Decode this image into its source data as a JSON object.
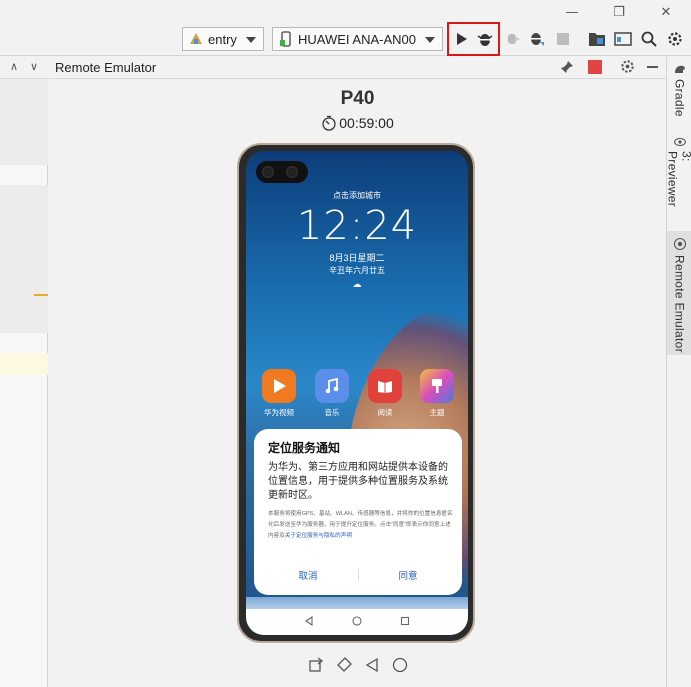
{
  "titlebar": {
    "minimize_glyph": "—",
    "restore_glyph": "❐",
    "close_glyph": "✕"
  },
  "toolbar": {
    "module_selector": "entry",
    "device_selector": "HUAWEI ANA-AN00",
    "icons": [
      "run-icon",
      "debug-icon",
      "attach-debugger-icon",
      "profile-icon",
      "stop-icon",
      "project-structure-icon",
      "sdk-manager-icon",
      "search-icon",
      "settings-icon"
    ]
  },
  "panel": {
    "title": "Remote Emulator",
    "device_name": "P40",
    "timer": "00:59:00"
  },
  "phone": {
    "lock_hint": "点击添加城市",
    "time": "12:24",
    "date": "8月3日星期二",
    "lunar": "辛丑年六月廿五",
    "apps": [
      {
        "label": "华为视频",
        "color": "#f07a22"
      },
      {
        "label": "音乐",
        "color": "#5a8ee8"
      },
      {
        "label": "阅读",
        "color": "#e0413b"
      },
      {
        "label": "主题",
        "color": "#d94dbd"
      }
    ],
    "dialog": {
      "title": "定位服务通知",
      "body": "为华为、第三方应用和网站提供本设备的位置信息，用于提供多种位置服务及系统更新时区。",
      "small": "本服务将使用GPS、基站、WLAN、传感器等信息，并将你的位置信息匿名化后发送至华为服务器，用于提升定位服务。点击“同意”即表示你同意上述内容及",
      "link": "关于定位服务与隐私的声明",
      "cancel": "取消",
      "agree": "同意"
    }
  },
  "sidebar_right": {
    "tabs": [
      {
        "label": "Gradle"
      },
      {
        "label": "3: Previewer"
      },
      {
        "label": "Remote Emulator"
      }
    ]
  }
}
